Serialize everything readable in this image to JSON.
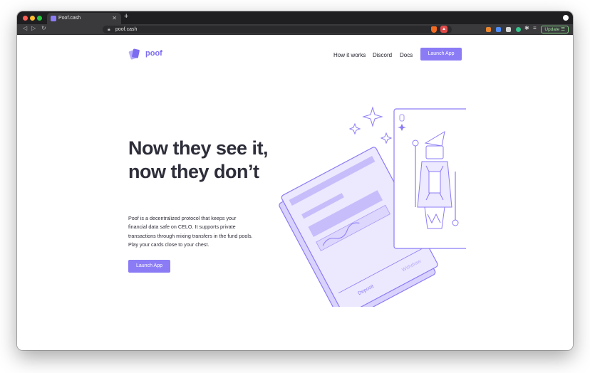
{
  "browser": {
    "tab_title": "Poof.cash",
    "new_tab": "+",
    "url": "poof.cash",
    "update_label": "Update"
  },
  "site": {
    "logo_text": "poof",
    "nav": [
      "How it works",
      "Discord",
      "Docs"
    ],
    "nav_cta": "Launch App"
  },
  "hero": {
    "title": "Now they see it, now they don’t",
    "description": "Poof is a decentralized protocol that keeps your financial data safe on CELO. It supports private transactions through mixing transfers in the fund pools. Play your cards close to your chest.",
    "cta": "Launch App"
  },
  "illustration": {
    "back_card_labels": [
      "Deposit",
      "Withdraw"
    ]
  },
  "colors": {
    "accent": "#8b7cf6",
    "text_dark": "#2e2e3a",
    "card_fill": "#e2dcfd",
    "browser_chrome": "#1f1f22"
  }
}
